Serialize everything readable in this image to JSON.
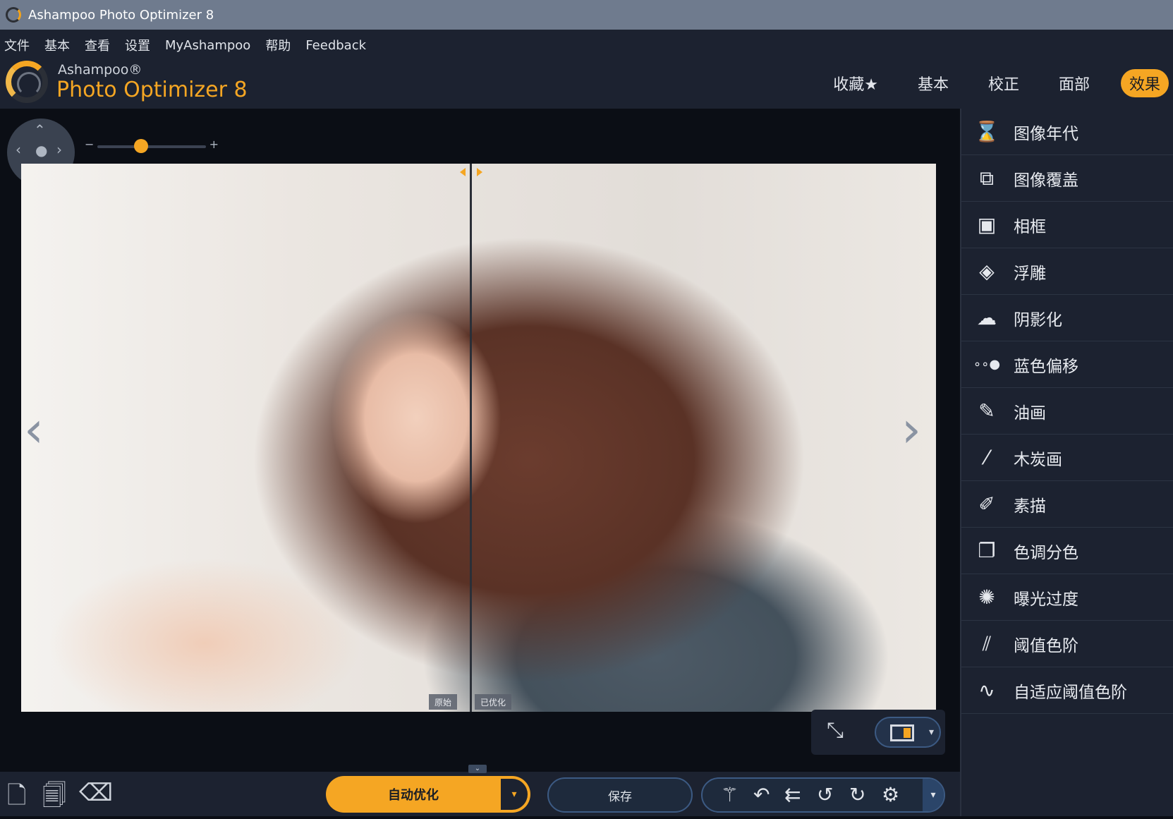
{
  "window": {
    "title": "Ashampoo Photo Optimizer 8"
  },
  "menu": [
    "文件",
    "基本",
    "查看",
    "设置",
    "MyAshampoo",
    "帮助",
    "Feedback"
  ],
  "logo": {
    "brand": "Ashampoo®",
    "product": "Photo Optimizer 8"
  },
  "tabs": [
    {
      "label": "收藏★",
      "active": false
    },
    {
      "label": "基本",
      "active": false
    },
    {
      "label": "校正",
      "active": false
    },
    {
      "label": "面部",
      "active": false
    },
    {
      "label": "效果",
      "active": true
    }
  ],
  "zoom": {
    "level_fraction": 0.4
  },
  "compare": {
    "left_label": "原始",
    "right_label": "已优化"
  },
  "sidebar": [
    {
      "label": "图像年代",
      "icon": "hourglass-icon"
    },
    {
      "label": "图像覆盖",
      "icon": "overlay-icon"
    },
    {
      "label": "相框",
      "icon": "frame-icon"
    },
    {
      "label": "浮雕",
      "icon": "emboss-icon"
    },
    {
      "label": "阴影化",
      "icon": "shadow-icon"
    },
    {
      "label": "蓝色偏移",
      "icon": "blue-shift-icon"
    },
    {
      "label": "油画",
      "icon": "brush-icon"
    },
    {
      "label": "木炭画",
      "icon": "charcoal-icon"
    },
    {
      "label": "素描",
      "icon": "pencil-icon"
    },
    {
      "label": "色调分色",
      "icon": "posterize-icon"
    },
    {
      "label": "曝光过度",
      "icon": "overexposure-icon"
    },
    {
      "label": "阈值色阶",
      "icon": "threshold-icon"
    },
    {
      "label": "自适应阈值色阶",
      "icon": "adaptive-threshold-icon"
    }
  ],
  "bottom": {
    "auto_optimize": "自动优化",
    "save": "保存"
  },
  "colors": {
    "accent": "#f5a623",
    "panel": "#1c2230",
    "titlebar": "#6f7b8e"
  }
}
